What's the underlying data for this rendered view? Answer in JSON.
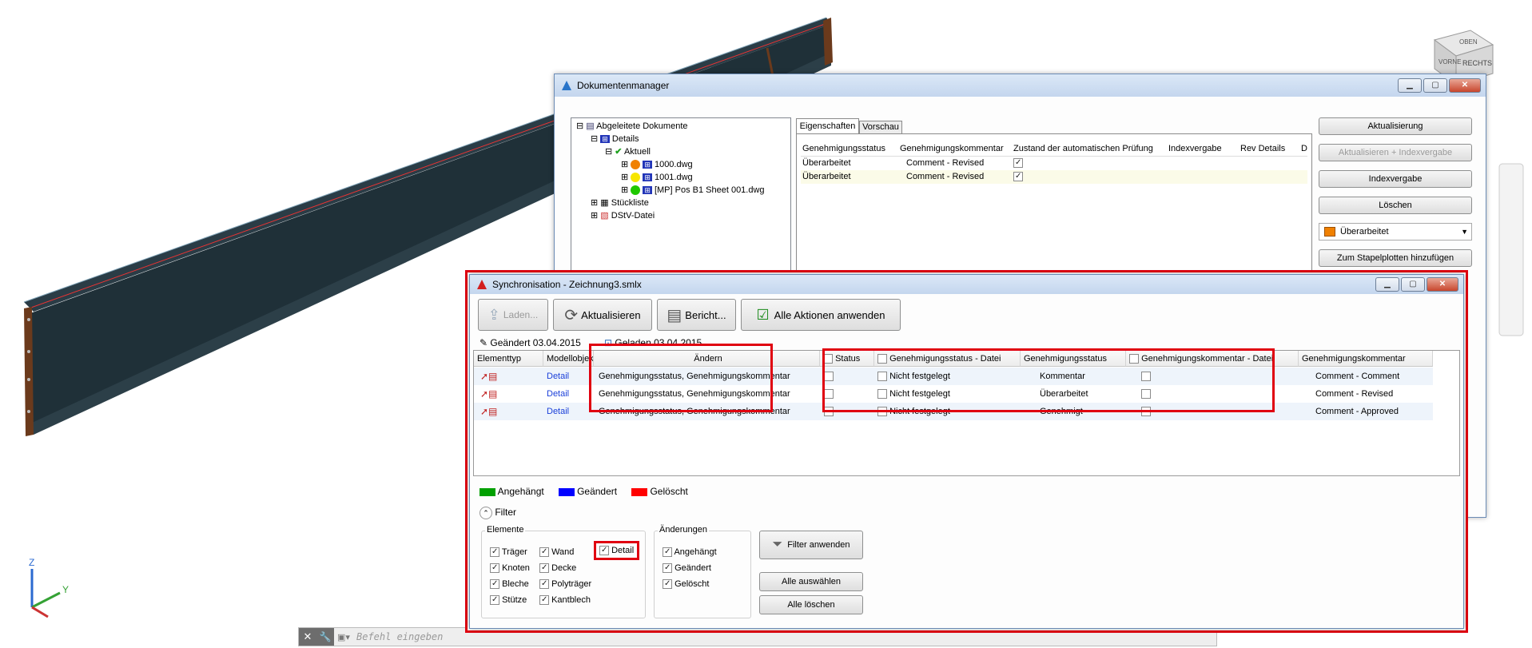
{
  "cmdline": {
    "placeholder": "Befehl eingeben"
  },
  "viewcube": {
    "top": "OBEN",
    "front": "VORNE",
    "right": "RECHTS"
  },
  "axes": {
    "z": "Z",
    "y": "Y"
  },
  "docmanager": {
    "title": "Dokumentenmanager",
    "tree": {
      "root": "Abgeleitete Dokumente",
      "details": "Details",
      "current": "Aktuell",
      "files": [
        {
          "name": "1000.dwg",
          "status_color": "#f08000"
        },
        {
          "name": "1001.dwg",
          "status_color": "#f7e600"
        },
        {
          "name": "[MP] Pos B1 Sheet 001.dwg",
          "status_color": "#1fc800"
        }
      ],
      "parts_list": "Stückliste",
      "dstv": "DStV-Datei"
    },
    "tabs": [
      "Eigenschaften",
      "Vorschau"
    ],
    "columns": [
      "Genehmigungsstatus",
      "Genehmigungskommentar",
      "Zustand der automatischen Prüfung",
      "Indexvergabe",
      "Rev Details",
      "D"
    ],
    "rows": [
      {
        "status": "Überarbeitet",
        "comment": "Comment - Revised",
        "check": true
      },
      {
        "status": "Überarbeitet",
        "comment": "Comment - Revised",
        "check": true
      }
    ],
    "buttons": {
      "update": "Aktualisierung",
      "update_index": "Aktualisieren + Indexvergabe",
      "index": "Indexvergabe",
      "delete": "Löschen",
      "batch": "Zum Stapelplotten hinzufügen"
    },
    "status_select": {
      "value": "Überarbeitet",
      "color": "#f08000"
    }
  },
  "sync": {
    "title": "Synchronisation - Zeichnung3.smlx",
    "toolbar": {
      "load": "Laden...",
      "refresh": "Aktualisieren",
      "report": "Bericht...",
      "apply_all": "Alle Aktionen anwenden"
    },
    "changed": "Geändert 03.04.2015",
    "loaded": "Geladen 03.04.2015",
    "columns": {
      "type": "Elementtyp",
      "model": "Modellobjekt",
      "change": "Ändern",
      "status": "Status",
      "approval_file": "Genehmigungsstatus - Datei",
      "approval": "Genehmigungsstatus",
      "comment_file": "Genehmigungskommentar - Datei",
      "comment": "Genehmigungskommentar"
    },
    "rows": [
      {
        "model": "Detail",
        "change": "Genehmigungsstatus, Genehmigungskommentar",
        "approval_file": "Nicht festgelegt",
        "approval": "Kommentar",
        "comment": "Comment - Comment"
      },
      {
        "model": "Detail",
        "change": "Genehmigungsstatus, Genehmigungskommentar",
        "approval_file": "Nicht festgelegt",
        "approval": "Überarbeitet",
        "comment": "Comment - Revised"
      },
      {
        "model": "Detail",
        "change": "Genehmigungsstatus, Genehmigungskommentar",
        "approval_file": "Nicht festgelegt",
        "approval": "Genehmigt",
        "comment": "Comment - Approved"
      }
    ],
    "legend": [
      {
        "label": "Angehängt",
        "color": "#00a000"
      },
      {
        "label": "Geändert",
        "color": "#0000ff"
      },
      {
        "label": "Gelöscht",
        "color": "#ff0000"
      }
    ],
    "filter": {
      "title": "Filter",
      "elements_title": "Elemente",
      "elements": {
        "traeger": "Träger",
        "wand": "Wand",
        "detail": "Detail",
        "knoten": "Knoten",
        "decke": "Decke",
        "bleche": "Bleche",
        "polytraeger": "Polyträger",
        "stuetze": "Stütze",
        "kantblech": "Kantblech"
      },
      "changes_title": "Änderungen",
      "changes": {
        "attached": "Angehängt",
        "changed": "Geändert",
        "deleted": "Gelöscht"
      },
      "apply": "Filter anwenden",
      "select_all": "Alle auswählen",
      "clear_all": "Alle löschen"
    }
  }
}
